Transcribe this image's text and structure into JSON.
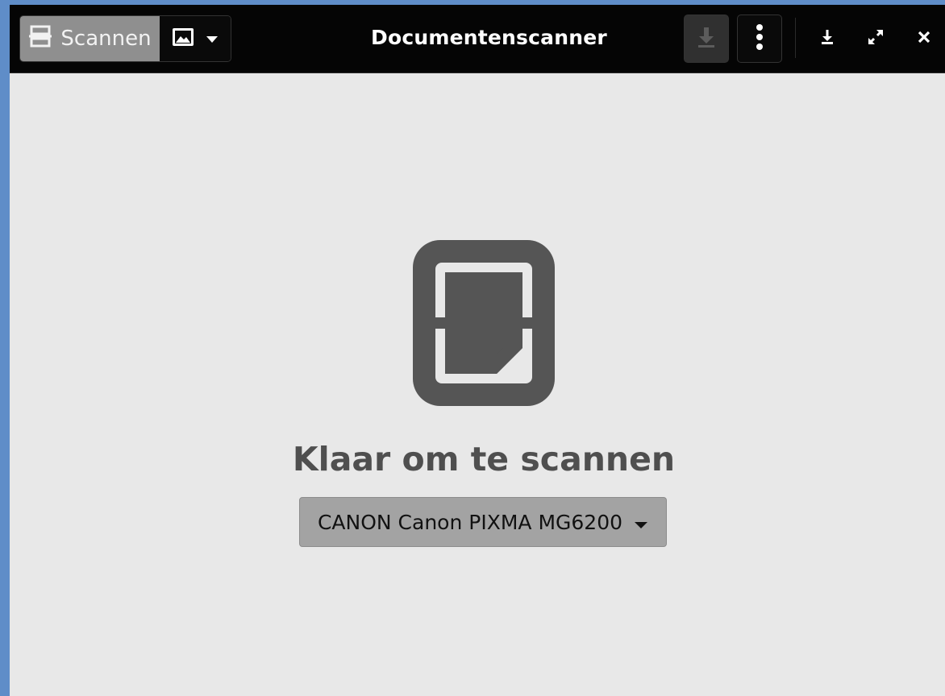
{
  "window": {
    "title": "Documentenscanner"
  },
  "headerbar": {
    "scan_label": "Scannen",
    "scan_icon": "scanner-icon",
    "scan_type_icon": "image-icon",
    "dropdown_icon": "chevron-down-icon",
    "save_icon": "download-icon",
    "menu_icon": "vertical-dots-icon",
    "minimize_icon": "minimize-icon",
    "maximize_icon": "maximize-icon",
    "close_icon": "close-icon"
  },
  "main": {
    "status_text": "Klaar om te scannen",
    "device": {
      "selected": "CANON Canon PIXMA MG6200"
    }
  },
  "colors": {
    "headerbar_bg": "#050505",
    "content_bg": "#e8e8e8",
    "icon_gray": "#555555",
    "desktop": "#5f8dc8"
  }
}
